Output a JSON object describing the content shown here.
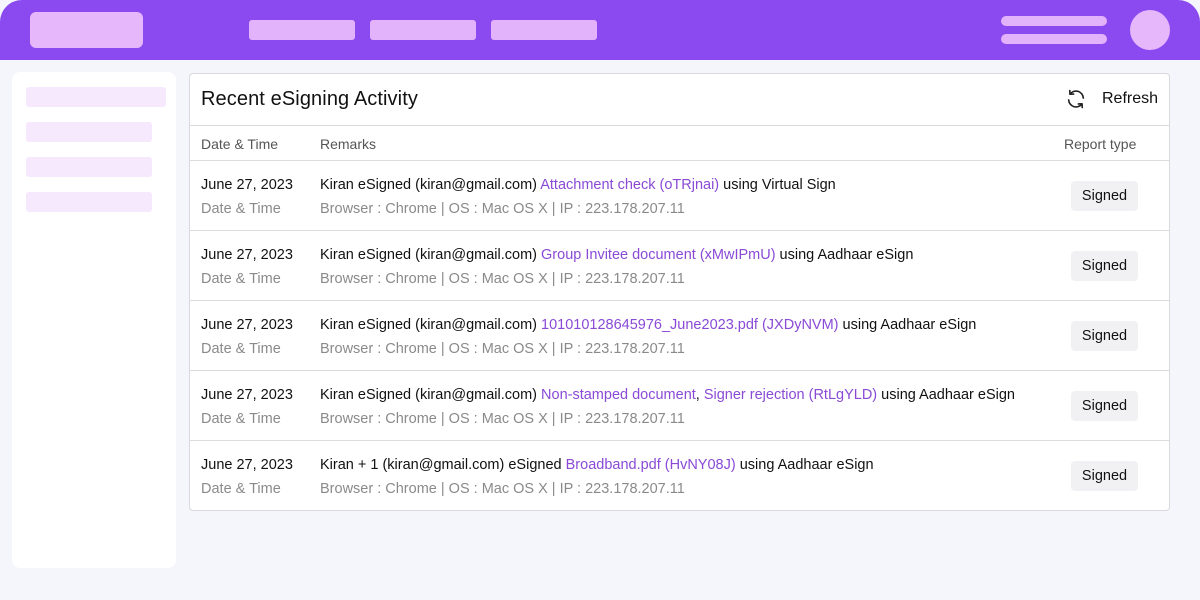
{
  "header": {
    "title": "Recent eSigning Activity",
    "refresh_label": "Refresh",
    "refresh_icon": "refresh-icon"
  },
  "columns": {
    "date": "Date & Time",
    "remarks": "Remarks",
    "report_type": "Report type"
  },
  "colors": {
    "brand": "#8a4af0",
    "link": "#8a4ad6",
    "badge_bg": "#f1f1f3"
  },
  "rows": [
    {
      "date": "June 27, 2023",
      "date_label": "Date & Time",
      "pre": "Kiran eSigned (kiran@gmail.com) ",
      "doc1": "Attachment check (oTRjnai)",
      "sep": "",
      "doc2": "",
      "post": " using Virtual Sign",
      "meta": "Browser : Chrome | OS : Mac OS X | IP : 223.178.207.11",
      "badge": "Signed"
    },
    {
      "date": "June 27, 2023",
      "date_label": "Date & Time",
      "pre": "Kiran eSigned (kiran@gmail.com) ",
      "doc1": "Group Invitee document (xMwIPmU)",
      "sep": "",
      "doc2": "",
      "post": " using Aadhaar eSign",
      "meta": "Browser : Chrome | OS : Mac OS X | IP : 223.178.207.11",
      "badge": "Signed"
    },
    {
      "date": "June 27, 2023",
      "date_label": "Date & Time",
      "pre": "Kiran eSigned (kiran@gmail.com) ",
      "doc1": "101010128645976_June2023.pdf (JXDyNVM)",
      "sep": "",
      "doc2": "",
      "post": " using Aadhaar eSign",
      "meta": "Browser : Chrome | OS : Mac OS X | IP : 223.178.207.11",
      "badge": "Signed"
    },
    {
      "date": "June 27, 2023",
      "date_label": "Date & Time",
      "pre": "Kiran eSigned (kiran@gmail.com) ",
      "doc1": "Non-stamped document",
      "sep": ", ",
      "doc2": "Signer rejection (RtLgYLD)",
      "post": " using Aadhaar eSign",
      "meta": "Browser : Chrome | OS : Mac OS X | IP : 223.178.207.11",
      "badge": "Signed"
    },
    {
      "date": "June 27, 2023",
      "date_label": "Date & Time",
      "pre": "Kiran + 1 (kiran@gmail.com) eSigned ",
      "doc1": "Broadband.pdf (HvNY08J)",
      "sep": "",
      "doc2": "",
      "post": " using Aadhaar eSign",
      "meta": "Browser : Chrome | OS : Mac OS X | IP : 223.178.207.11",
      "badge": "Signed"
    }
  ]
}
